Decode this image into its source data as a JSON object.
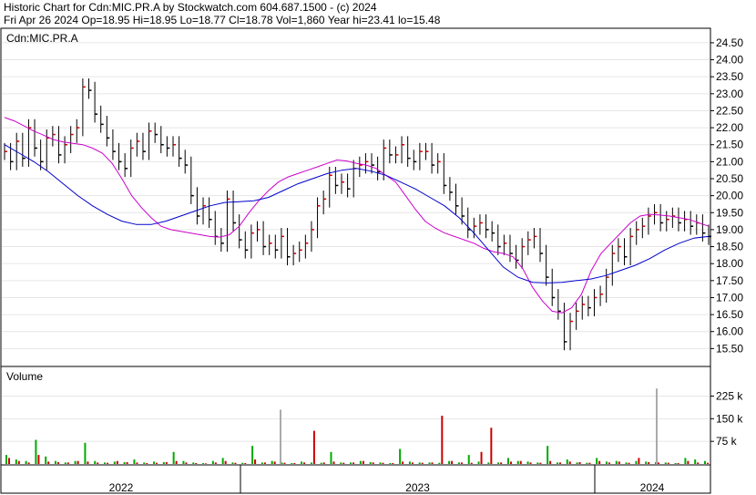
{
  "header": {
    "line1": "Historic Chart for Cdn:MIC.PR.A by Stockwatch.com 604.687.1500 - (c) 2024",
    "line2": "Fri Apr 26 2024   Op=18.95   Hi=18.95   Lo=18.77   Cl=18.78   Vol=1,860   Year hi=23.41   lo=15.48"
  },
  "chart_data": [
    {
      "type": "line",
      "title": "Cdn:MIC.PR.A",
      "ylim": [
        15.0,
        24.9
      ],
      "y_ticks": [
        "24.50",
        "24.00",
        "23.50",
        "23.00",
        "22.50",
        "22.00",
        "21.50",
        "21.00",
        "20.50",
        "20.00",
        "19.50",
        "19.00",
        "18.50",
        "18.00",
        "17.50",
        "17.00",
        "16.50",
        "16.00",
        "15.50"
      ],
      "x_tick_labels": [
        "2022",
        "2023",
        "2024"
      ],
      "series": [
        {
          "style": "ohlc",
          "color": "#000000",
          "markers": {
            "up": "#cc0000",
            "down": "#000000"
          },
          "values": [
            21.3,
            21.0,
            21.6,
            21.1,
            22.0,
            21.4,
            21.0,
            21.7,
            21.8,
            21.2,
            21.5,
            21.8,
            22.0,
            23.2,
            23.1,
            22.4,
            22.1,
            21.7,
            21.3,
            21.0,
            20.8,
            21.4,
            21.6,
            21.3,
            21.9,
            21.8,
            21.5,
            21.4,
            21.5,
            21.1,
            20.9,
            20.0,
            19.4,
            19.7,
            19.3,
            18.8,
            18.6,
            19.9,
            19.2,
            18.7,
            18.4,
            18.9,
            19.0,
            18.5,
            18.6,
            18.4,
            18.8,
            18.2,
            18.3,
            18.4,
            18.6,
            19.0,
            19.7,
            19.9,
            20.6,
            20.3,
            20.4,
            20.2,
            20.8,
            20.9,
            21.0,
            20.9,
            20.7,
            21.4,
            21.2,
            21.2,
            21.5,
            21.1,
            21.0,
            21.3,
            21.3,
            20.9,
            21.0,
            20.3,
            20.1,
            19.7,
            19.4,
            19.0,
            19.1,
            19.2,
            19.0,
            18.9,
            18.5,
            18.6,
            18.3,
            18.1,
            18.5,
            18.7,
            18.8,
            18.3,
            17.6,
            17.0,
            16.6,
            15.7,
            16.3,
            16.6,
            16.8,
            16.7,
            17.0,
            17.1,
            17.6,
            18.3,
            18.5,
            18.2,
            18.8,
            19.0,
            19.1,
            19.4,
            19.5,
            19.2,
            19.3,
            19.4,
            19.2,
            19.3,
            19.1,
            19.2,
            18.9,
            18.8
          ]
        },
        {
          "name": "",
          "color": "#cc00cc",
          "values": [
            22.3,
            22.2,
            22.05,
            21.9,
            21.78,
            21.65,
            21.58,
            21.54,
            21.5,
            21.4,
            21.25,
            20.95,
            20.5,
            20.0,
            19.65,
            19.35,
            19.1,
            19.0,
            18.95,
            18.9,
            18.85,
            18.8,
            18.78,
            18.85,
            19.1,
            19.5,
            19.85,
            20.15,
            20.4,
            20.55,
            20.65,
            20.75,
            20.85,
            20.95,
            21.05,
            21.02,
            20.95,
            20.9,
            20.8,
            20.6,
            20.4,
            20.0,
            19.6,
            19.25,
            19.05,
            18.9,
            18.8,
            18.7,
            18.6,
            18.45,
            18.35,
            18.3,
            18.2,
            17.85,
            17.3,
            16.9,
            16.6,
            16.55,
            16.7,
            17.1,
            17.8,
            18.3,
            18.6,
            18.9,
            19.2,
            19.4,
            19.45,
            19.43,
            19.4,
            19.35,
            19.3,
            19.2,
            19.1
          ]
        },
        {
          "name": "",
          "color": "#0000cc",
          "values": [
            21.5,
            21.25,
            21.0,
            20.7,
            20.35,
            20.0,
            19.7,
            19.45,
            19.25,
            19.15,
            19.15,
            19.25,
            19.4,
            19.55,
            19.7,
            19.8,
            19.82,
            19.85,
            19.95,
            20.15,
            20.35,
            20.5,
            20.65,
            20.75,
            20.8,
            20.72,
            20.6,
            20.4,
            20.2,
            19.95,
            19.7,
            19.35,
            18.9,
            18.4,
            17.9,
            17.6,
            17.45,
            17.43,
            17.45,
            17.5,
            17.55,
            17.65,
            17.8,
            17.95,
            18.15,
            18.4,
            18.6,
            18.75,
            18.8
          ]
        }
      ]
    },
    {
      "type": "bar",
      "title": "Volume",
      "ylim": [
        0,
        320
      ],
      "y_ticks": [
        "225 k",
        "150 k",
        "75 k"
      ],
      "series": [
        {
          "name": "",
          "color": "#00aa00",
          "values": [
            30,
            15,
            10,
            80,
            25,
            10,
            5,
            10,
            70,
            10,
            5,
            8,
            6,
            15,
            5,
            8,
            6,
            40,
            10,
            5,
            3,
            10,
            20,
            5,
            4,
            60,
            5,
            10,
            5,
            3,
            8,
            5,
            4,
            40,
            5,
            5,
            10,
            6,
            5,
            3,
            50,
            8,
            5,
            5,
            4,
            10,
            5,
            30,
            8,
            5,
            5,
            20,
            10,
            8,
            5,
            60,
            5,
            15,
            5,
            4,
            20,
            8,
            10,
            5,
            10,
            8,
            6,
            5,
            3,
            20,
            15,
            10
          ]
        },
        {
          "name": "",
          "color": "#cc0000",
          "values": [
            20,
            10,
            5,
            30,
            8,
            6,
            5,
            10,
            8,
            5,
            4,
            10,
            6,
            5,
            3,
            4,
            6,
            10,
            5,
            3,
            2,
            5,
            10,
            4,
            3,
            15,
            5,
            8,
            4,
            3,
            5,
            110,
            5,
            8,
            4,
            5,
            10,
            5,
            4,
            3,
            8,
            5,
            4,
            5,
            160,
            10,
            5,
            4,
            40,
            120,
            5,
            8,
            10,
            5,
            4,
            10,
            5,
            8,
            6,
            4,
            10,
            5,
            8,
            4,
            20,
            6,
            5,
            4,
            3,
            10,
            5,
            4
          ]
        },
        {
          "name": "",
          "color": "#aaaaaa",
          "values": [
            0,
            0,
            0,
            0,
            0,
            180,
            0,
            0,
            0,
            0,
            0,
            0,
            250,
            0
          ]
        }
      ]
    }
  ]
}
